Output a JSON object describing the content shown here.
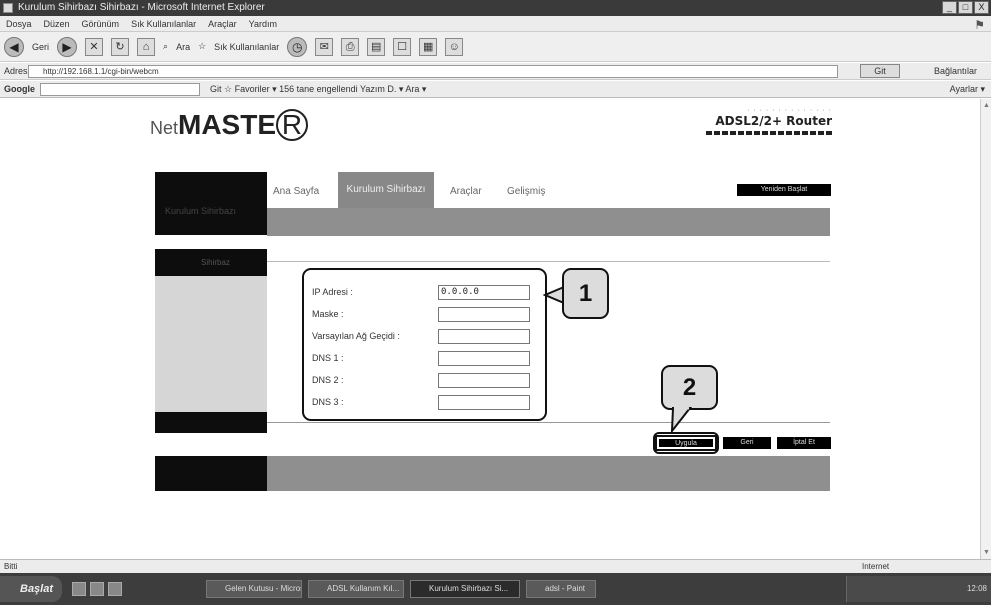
{
  "window": {
    "title": "Kurulum Sihirbazı Sihirbazı - Microsoft Internet Explorer",
    "controls": [
      "_",
      "□",
      "X"
    ]
  },
  "menu": [
    "Dosya",
    "Düzen",
    "Görünüm",
    "Sık Kullanılanlar",
    "Araçlar",
    "Yardım"
  ],
  "toolbar": {
    "back": "Geri",
    "search": "Ara",
    "favorites": "Sık Kullanılanlar"
  },
  "address": {
    "label": "Adres",
    "url": "http://192.168.1.1/cgi-bin/webcm",
    "go": "Git",
    "links": "Bağlantılar"
  },
  "googlebar": {
    "logo": "Google",
    "items": "Git   ☆ Favoriler ▾   156 tane engellendi   Yazım D. ▾   Ara ▾",
    "settings": "Ayarlar ▾"
  },
  "page": {
    "brand_prefix": "Net",
    "brand_main": "MASTE",
    "brand_circle": "R",
    "product": "ADSL2/2+ Router",
    "side_header": "Kurulum Sihirbazı",
    "tabs": [
      "Ana Sayfa",
      "Kurulum Sihirbazı",
      "Araçlar",
      "Gelişmiş"
    ],
    "save_reboot": "Yeniden Başlat",
    "side_section": "Sihirbaz",
    "form": {
      "ip_label": "IP Adresi :",
      "ip_value": "0.0.0.0",
      "mask_label": "Maske :",
      "gateway_label": "Varsayılan Ağ Geçidi :",
      "dns1_label": "DNS 1 :",
      "dns2_label": "DNS 2 :",
      "dns3_label": "DNS 3 :"
    },
    "buttons": {
      "apply": "Uygula",
      "back": "Geri",
      "cancel": "İptal Et"
    },
    "callouts": [
      "1",
      "2"
    ]
  },
  "status": {
    "left": "Bitti",
    "zone": "Internet"
  },
  "taskbar": {
    "start": "Başlat",
    "tasks": [
      "Gelen Kutusu - Micros...",
      "ADSL Kullanım Kıl...",
      "Kurulum Sihirbazı Si...",
      "adsl - Paint"
    ],
    "clock": "12:08"
  }
}
